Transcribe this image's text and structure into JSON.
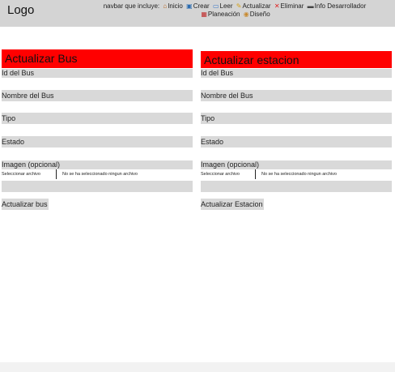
{
  "header": {
    "logo": "Logo",
    "nav_prefix": "navbar que incluye:",
    "nav_items": [
      {
        "icon": "house-icon",
        "label": "Inicio"
      },
      {
        "icon": "new-icon",
        "label": "Crear"
      },
      {
        "icon": "book-icon",
        "label": "Leer"
      },
      {
        "icon": "pencil-icon",
        "label": "Actualizar"
      },
      {
        "icon": "cross-icon",
        "label": "Eliminar"
      },
      {
        "icon": "laptop-icon",
        "label": "Info Desarrollador"
      },
      {
        "icon": "calendar-icon",
        "label": "Planeación"
      },
      {
        "icon": "palette-icon",
        "label": "Diseño"
      }
    ]
  },
  "bus_form": {
    "title": "Actualizar Bus",
    "id_label": "Id del Bus",
    "name_label": "Nombre del Bus",
    "type_label": "Tipo",
    "state_label": "Estado",
    "image_label": "Imagen (opcional)",
    "file_button": "Seleccionar archivo",
    "file_status": "No se ha seleccionado ningun archivo",
    "submit": "Actualizar bus"
  },
  "station_form": {
    "title": "Actualizar estacion",
    "id_label": "Id del Bus",
    "name_label": "Nombre del Bus",
    "type_label": "Tipo",
    "state_label": "Estado",
    "image_label": "Imagen (opcional)",
    "file_button": "Seleccionar archivo",
    "file_status": "No se ha seleccionado ningun archivo",
    "submit": "Actualizar Estacion"
  },
  "colors": {
    "title_bg": "#ff0000",
    "header_bg": "#d4d4d4",
    "field_bg": "#d9d9d9"
  }
}
